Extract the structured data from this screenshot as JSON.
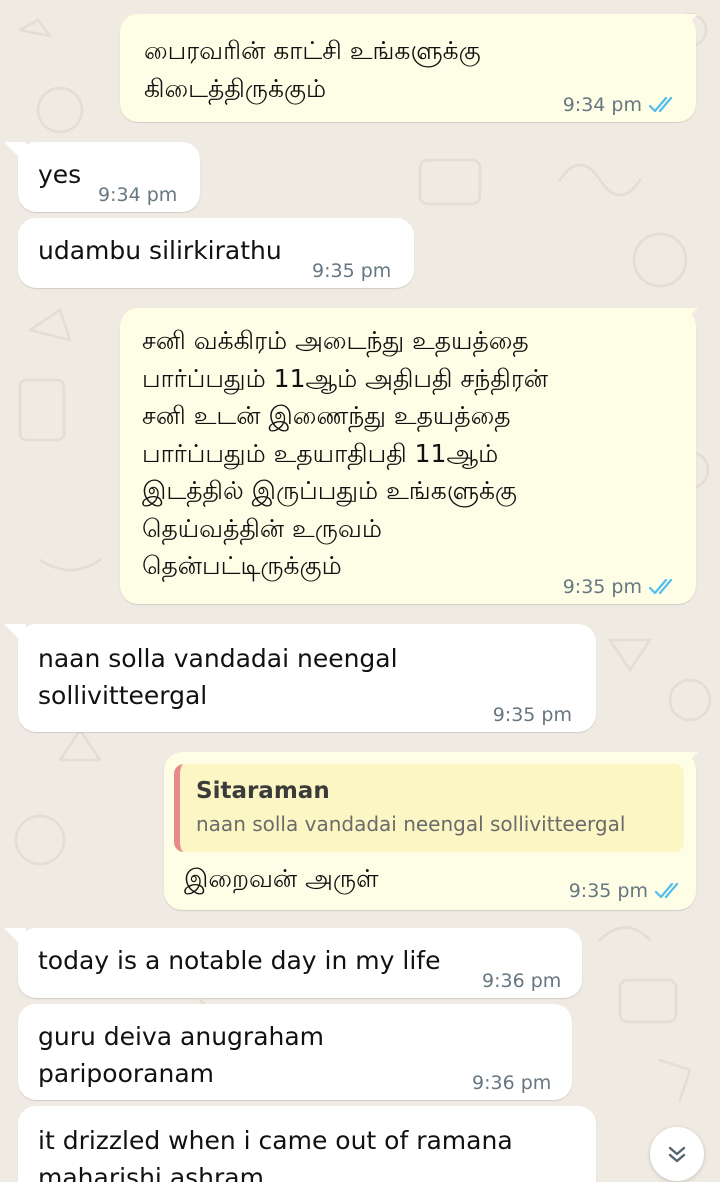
{
  "messages": [
    {
      "direction": "outgoing",
      "text": "பைரவரின் காட்சி உங்களுக்கு\nகிடைத்திருக்கும்",
      "time": "9:34 pm",
      "status": "read-double-check"
    },
    {
      "direction": "incoming",
      "text": "yes",
      "time": "9:34 pm"
    },
    {
      "direction": "incoming",
      "text": "udambu silirkirathu",
      "time": "9:35 pm"
    },
    {
      "direction": "outgoing",
      "text": "சனி வக்கிரம் அடைந்து உதயத்தை\nபார்ப்பதும் 11ஆம் அதிபதி சந்திரன்\nசனி உடன் இணைந்து உதயத்தை\nபார்ப்பதும் உதயாதிபதி 11ஆம்\nஇடத்தில் இருப்பதும் உங்களுக்கு\nதெய்வத்தின் உருவம்\nதென்பட்டிருக்கும்",
      "time": "9:35 pm",
      "status": "read-double-check"
    },
    {
      "direction": "incoming",
      "text": "naan solla vandadai neengal\nsollivitteergal",
      "time": "9:35 pm"
    },
    {
      "direction": "outgoing",
      "reply_to": {
        "author": "Sitaraman",
        "text": "naan solla vandadai neengal sollivitteergal"
      },
      "text": "இறைவன் அருள்",
      "time": "9:35 pm",
      "status": "read-double-check"
    },
    {
      "direction": "incoming",
      "text": "today is a notable day in my life",
      "time": "9:36 pm"
    },
    {
      "direction": "incoming",
      "text": "guru deiva anugraham\nparipooranam",
      "time": "9:36 pm"
    },
    {
      "direction": "incoming",
      "text": "it drizzled when i came out of ramana\nmaharishi ashram",
      "time": ""
    }
  ],
  "colors": {
    "background": "#efeae2",
    "outgoing_bubble": "#fefde6",
    "incoming_bubble": "#ffffff",
    "read_ticks": "#53bdeb",
    "quote_bar": "#e88a8a",
    "quote_bg": "#fbf6c3",
    "timestamp": "#667781"
  },
  "icons": {
    "read_status": "double-check-icon",
    "scroll_down": "double-chevron-down-icon"
  }
}
